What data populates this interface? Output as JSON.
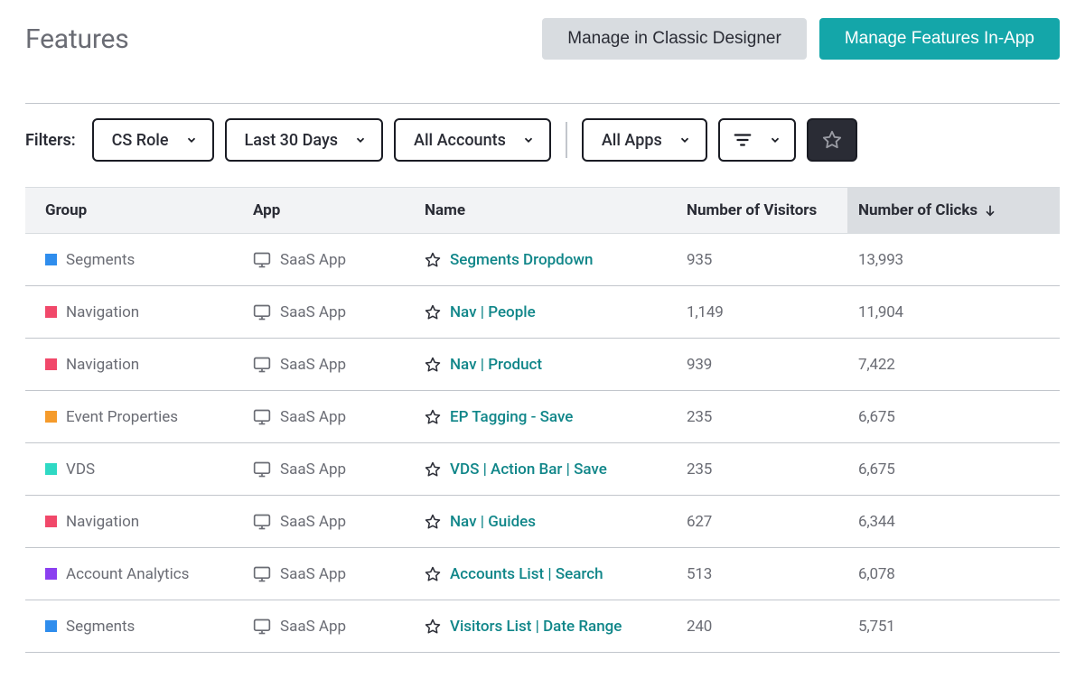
{
  "header": {
    "title": "Features",
    "btn_secondary": "Manage in Classic Designer",
    "btn_primary": "Manage Features In-App"
  },
  "filters": {
    "label": "Filters:",
    "role": "CS Role",
    "date": "Last 30 Days",
    "accounts": "All Accounts",
    "apps": "All Apps"
  },
  "columns": {
    "group": "Group",
    "app": "App",
    "name": "Name",
    "visitors": "Number of Visitors",
    "clicks": "Number of Clicks"
  },
  "group_colors": {
    "Segments": "#2F8DED",
    "Navigation": "#F1486A",
    "Event Properties": "#F59B2B",
    "VDS": "#2FD9C4",
    "Account Analytics": "#8B3FF0"
  },
  "rows": [
    {
      "group": "Segments",
      "app": "SaaS App",
      "name": "Segments Dropdown",
      "visitors": "935",
      "clicks": "13,993"
    },
    {
      "group": "Navigation",
      "app": "SaaS App",
      "name": "Nav | People",
      "visitors": "1,149",
      "clicks": "11,904"
    },
    {
      "group": "Navigation",
      "app": "SaaS App",
      "name": "Nav | Product",
      "visitors": "939",
      "clicks": "7,422"
    },
    {
      "group": "Event Properties",
      "app": "SaaS App",
      "name": "EP Tagging - Save",
      "visitors": "235",
      "clicks": "6,675"
    },
    {
      "group": "VDS",
      "app": "SaaS App",
      "name": "VDS | Action Bar | Save",
      "visitors": "235",
      "clicks": "6,675"
    },
    {
      "group": "Navigation",
      "app": "SaaS App",
      "name": "Nav | Guides",
      "visitors": "627",
      "clicks": "6,344"
    },
    {
      "group": "Account Analytics",
      "app": "SaaS App",
      "name": "Accounts List | Search",
      "visitors": "513",
      "clicks": "6,078"
    },
    {
      "group": "Segments",
      "app": "SaaS App",
      "name": "Visitors List | Date Range",
      "visitors": "240",
      "clicks": "5,751"
    }
  ]
}
